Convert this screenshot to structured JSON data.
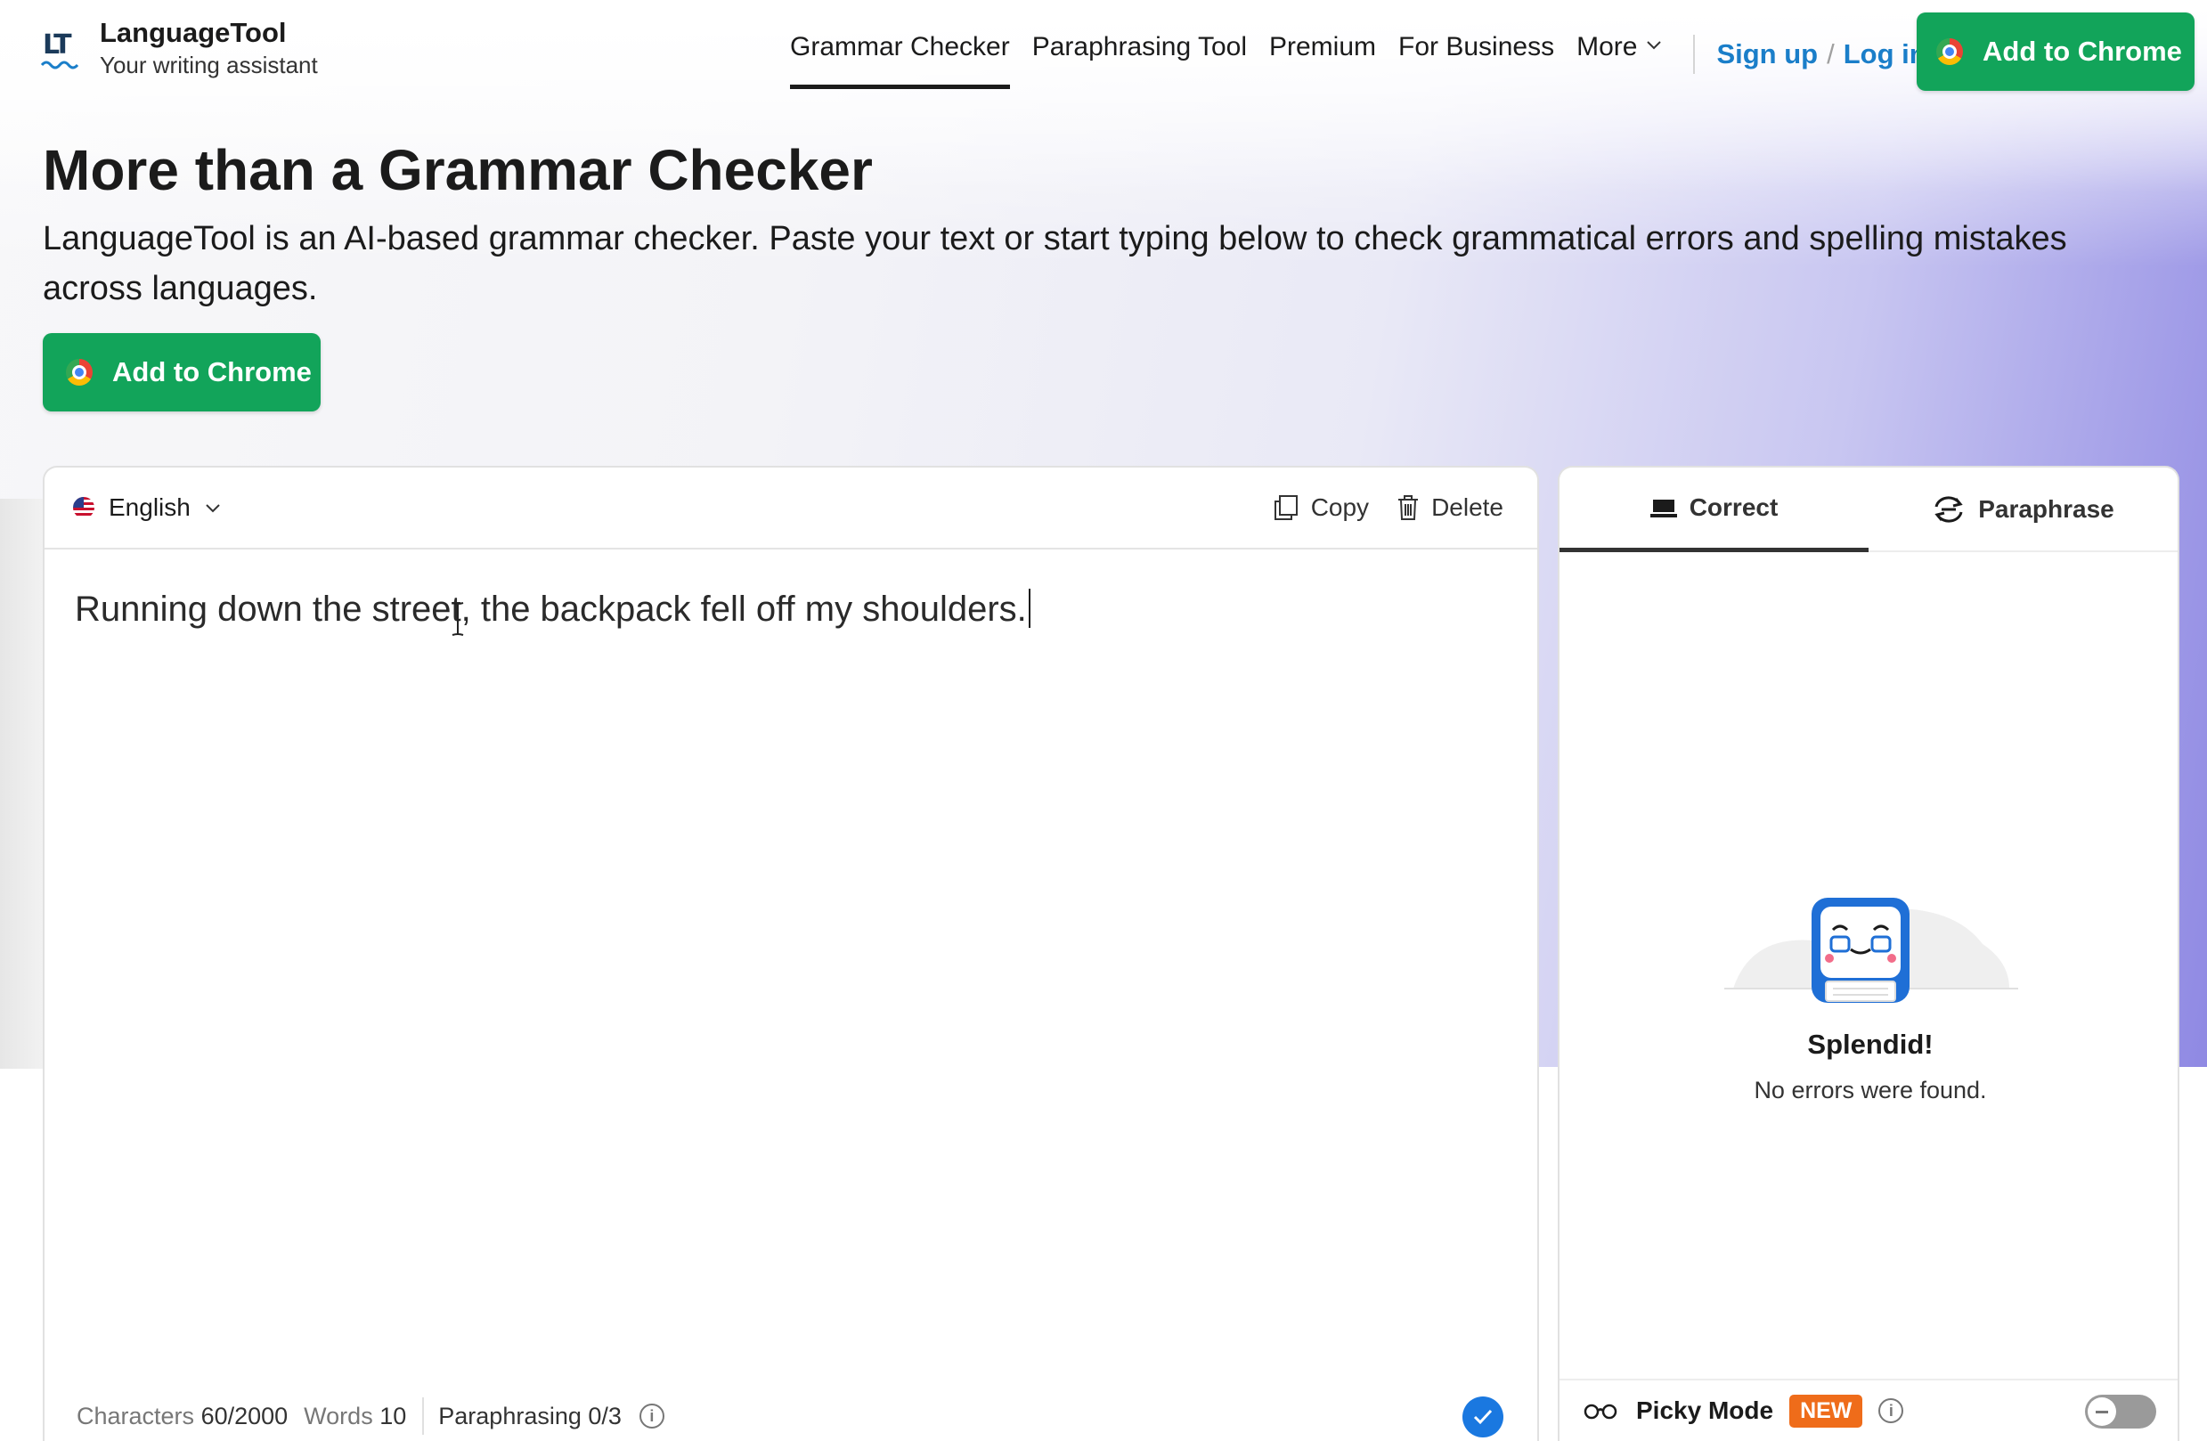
{
  "brand": {
    "name": "LanguageTool",
    "tagline": "Your writing assistant"
  },
  "nav": {
    "links": [
      {
        "label": "Grammar Checker",
        "active": true
      },
      {
        "label": "Paraphrasing Tool",
        "active": false
      },
      {
        "label": "Premium",
        "active": false
      },
      {
        "label": "For Business",
        "active": false
      },
      {
        "label": "More",
        "active": false
      }
    ],
    "signup": "Sign up",
    "separator": "/",
    "login": "Log in",
    "cta": "Add to Chrome"
  },
  "hero": {
    "title": "More than a Grammar Checker",
    "description": "LanguageTool is an AI-based grammar checker. Paste your text or start typing below to check grammatical errors and spelling mistakes across languages.",
    "cta": "Add to Chrome"
  },
  "editor": {
    "language": "English",
    "copy_label": "Copy",
    "delete_label": "Delete",
    "text": "Running down the street, the backpack fell off my shoulders.",
    "footer": {
      "characters_label": "Characters",
      "characters_value": "60/2000",
      "words_label": "Words",
      "words_value": "10",
      "paraphrasing_label": "Paraphrasing",
      "paraphrasing_value": "0/3"
    }
  },
  "panel": {
    "tabs": [
      {
        "label": "Correct",
        "active": true,
        "icon": "laptop-icon"
      },
      {
        "label": "Paraphrase",
        "active": false,
        "icon": "paraphrase-icon"
      }
    ],
    "result_title": "Splendid!",
    "result_message": "No errors were found.",
    "picky_mode_label": "Picky Mode",
    "picky_badge": "NEW",
    "picky_enabled": false
  },
  "colors": {
    "brand_green": "#12a45a",
    "link_blue": "#1a7ec9",
    "badge_orange": "#ef6c1a",
    "check_blue": "#1a78e0"
  }
}
